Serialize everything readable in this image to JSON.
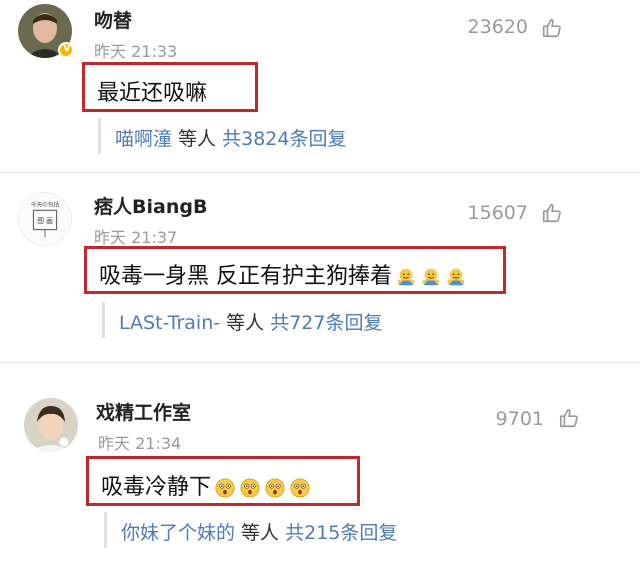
{
  "comments": [
    {
      "username": "吻替",
      "time": "昨天 21:33",
      "likes": "23620",
      "text": "最近还吸嘛",
      "emojis": [],
      "reply_author": "喵啊潼",
      "reply_mid": " 等人 ",
      "reply_count": "共3824条回复",
      "verified": true
    },
    {
      "username": "痞人BiangB",
      "time": "昨天 21:37",
      "likes": "15607",
      "text": "吸毒一身黑 反正有护主狗捧着",
      "emojis": [
        "hug-emoji",
        "hug-emoji",
        "hug-emoji"
      ],
      "reply_author": "LASt-Train-",
      "reply_mid": " 等人 ",
      "reply_count": "共727条回复",
      "verified": false
    },
    {
      "username": "戏精工作室",
      "time": "昨天 21:34",
      "likes": "9701",
      "text": "吸毒冷静下",
      "emojis": [
        "shocked-emoji",
        "shocked-emoji",
        "shocked-emoji",
        "shocked-emoji"
      ],
      "reply_author": "你妹了个妹的",
      "reply_mid": " 等人 ",
      "reply_count": "共215条回复",
      "verified": false
    }
  ],
  "colors": {
    "highlight_border": "#c0282d",
    "link_blue": "#4e7bb8",
    "meta_gray": "#9a9a9a"
  }
}
